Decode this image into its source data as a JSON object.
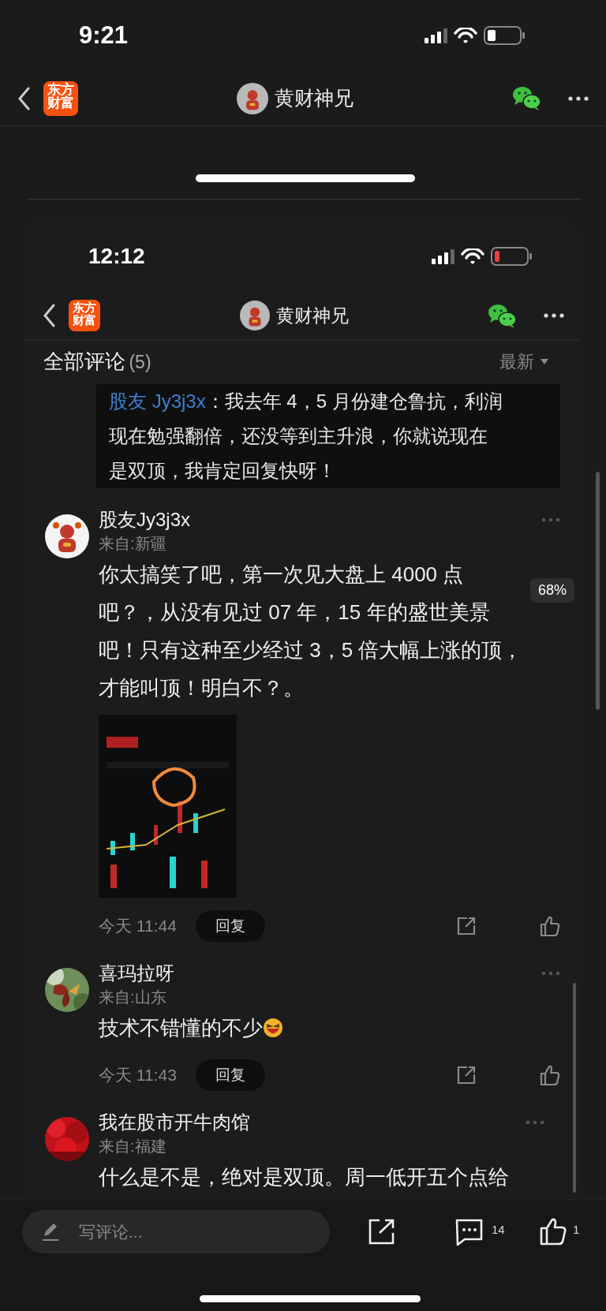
{
  "outer_status_bar": {
    "time": "9:21"
  },
  "outer_nav": {
    "logo": [
      "东方",
      "财富"
    ],
    "title": "黄财神兄"
  },
  "inner_status_bar": {
    "time": "12:12"
  },
  "inner_nav": {
    "logo": [
      "东方",
      "财富"
    ],
    "title": "黄财神兄"
  },
  "comments_header": {
    "title": "全部评论",
    "count": "(5)",
    "sort": "最新"
  },
  "quoted_reply": {
    "author": "股友 Jy3j3x",
    "separator": "：",
    "lines": [
      "我去年 4，5 月份建仓鲁抗，利润",
      "现在勉强翻倍，还没等到主升浪，你就说现在",
      "是双顶，我肯定回复快呀！"
    ]
  },
  "comments": [
    {
      "author": "股友Jy3j3x",
      "location": "来自:新疆",
      "lines": [
        "你太搞笑了吧，第一次见大盘上 4000 点",
        "吧？，从没有见过 07 年，15 年的盛世美景",
        "吧！只有这种至少经过 3，5 倍大幅上涨的顶，",
        "才能叫顶！明白不？。"
      ],
      "has_image": true,
      "emoji": false,
      "time": "今天 11:44",
      "reply": "回复"
    },
    {
      "author": "喜玛拉呀",
      "location": "来自:山东",
      "lines": [
        "技术不错懂的不少"
      ],
      "has_image": false,
      "emoji": true,
      "time": "今天 11:43",
      "reply": "回复"
    },
    {
      "author": "我在股市开牛肉馆",
      "location": "来自:福建",
      "lines": [
        "什么是不是，绝对是双顶。周一低开五个点给"
      ],
      "has_image": false,
      "emoji": false
    }
  ],
  "scroll_tooltip": "68%",
  "bottom_bar": {
    "placeholder": "写评论...",
    "comment_count": "14",
    "like_count": "1"
  }
}
